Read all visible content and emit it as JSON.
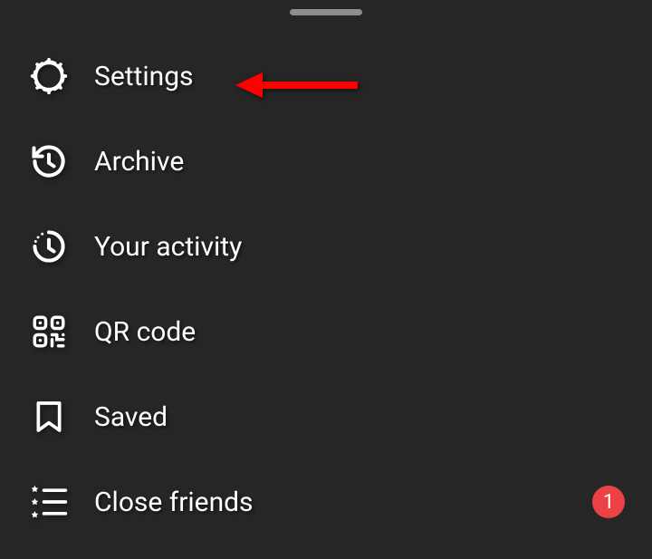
{
  "menu": {
    "items": [
      {
        "id": "settings",
        "label": "Settings"
      },
      {
        "id": "archive",
        "label": "Archive"
      },
      {
        "id": "your-activity",
        "label": "Your activity"
      },
      {
        "id": "qr-code",
        "label": "QR code"
      },
      {
        "id": "saved",
        "label": "Saved"
      },
      {
        "id": "close-friends",
        "label": "Close friends",
        "badge": "1"
      }
    ]
  },
  "colors": {
    "badge": "#ed4245",
    "annotation": "#ff0000"
  },
  "annotation": {
    "target": "settings"
  }
}
